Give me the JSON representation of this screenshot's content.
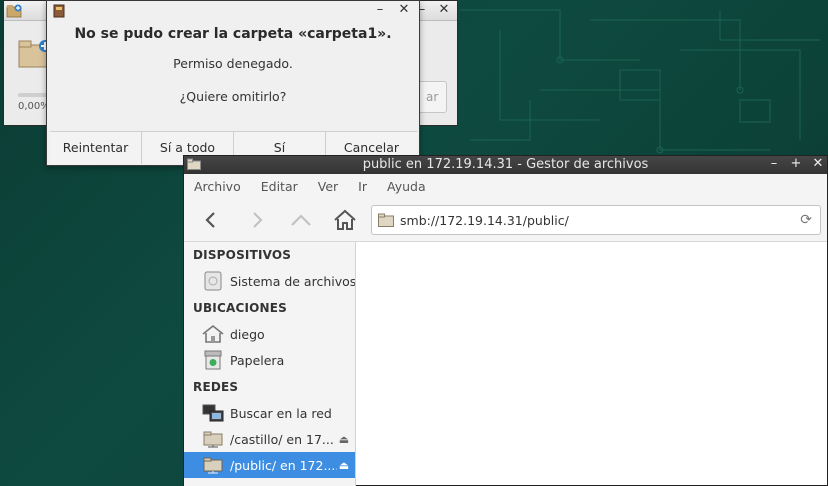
{
  "progress_window": {
    "percent_text": "0,00%",
    "cancel_fragment": "ar"
  },
  "dialog": {
    "heading": "No se pudo crear la carpeta «carpeta1».",
    "message": "Permiso denegado.",
    "question": "¿Quiere omitirlo?",
    "buttons": [
      "Reintentar",
      "Sí a todo",
      "Sí",
      "Cancelar"
    ],
    "window_buttons": {
      "minimize": "–",
      "close": "✕"
    }
  },
  "file_manager": {
    "title": "public en 172.19.14.31 - Gestor de archivos",
    "window_buttons": {
      "minimize": "–",
      "maximize": "+",
      "close": "✕"
    },
    "menu": [
      "Archivo",
      "Editar",
      "Ver",
      "Ir",
      "Ayuda"
    ],
    "location": "smb://172.19.14.31/public/",
    "sidebar": {
      "devices_header": "DISPOSITIVOS",
      "devices": [
        {
          "label": "Sistema de archivos",
          "icon": "drive-icon"
        }
      ],
      "places_header": "UBICACIONES",
      "places": [
        {
          "label": "diego",
          "icon": "home-icon"
        },
        {
          "label": "Papelera",
          "icon": "trash-icon"
        }
      ],
      "network_header": "REDES",
      "network": [
        {
          "label": "Buscar en la red",
          "icon": "network-icon"
        },
        {
          "label": "/castillo/ en 17...",
          "icon": "network-folder-icon",
          "eject": "⏏"
        },
        {
          "label": "/public/ en 172....",
          "icon": "network-folder-icon",
          "eject": "⏏",
          "selected": true
        }
      ]
    }
  },
  "colors": {
    "desktop": "#0d3a33",
    "selection": "#3d8ee2",
    "titlebar_dark": "#3c3c3c"
  }
}
